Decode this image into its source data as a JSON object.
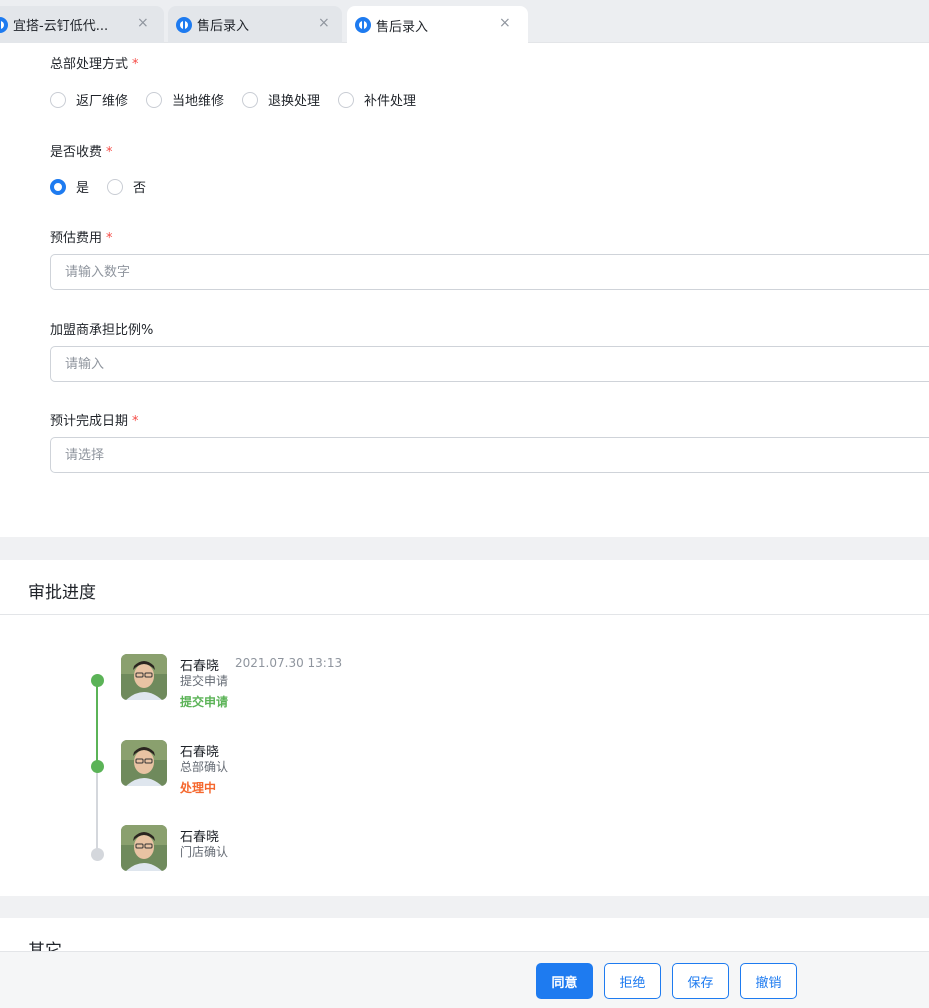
{
  "tabs": [
    {
      "title": "宜搭-云钉低代...",
      "close": "×"
    },
    {
      "title": "售后录入",
      "close": "×"
    },
    {
      "title": "售后录入",
      "close": "×"
    }
  ],
  "form": {
    "hq_method": {
      "label": "总部处理方式",
      "required_mark": "*",
      "options": [
        "返厂维修",
        "当地维修",
        "退换处理",
        "补件处理"
      ],
      "selected": null
    },
    "charge": {
      "label": "是否收费",
      "required_mark": "*",
      "options": [
        "是",
        "否"
      ],
      "selected": "是"
    },
    "estimated_fee": {
      "label": "预估费用",
      "required_mark": "*",
      "placeholder": "请输入数字",
      "value": ""
    },
    "franchisee_ratio": {
      "label": "加盟商承担比例%",
      "placeholder": "请输入",
      "value": ""
    },
    "expected_date": {
      "label": "预计完成日期",
      "required_mark": "*",
      "placeholder": "请选择",
      "value": ""
    }
  },
  "approval": {
    "title": "审批进度",
    "steps": [
      {
        "name": "石春晓",
        "time": "2021.07.30 13:13",
        "step": "提交申请",
        "status": "提交申请",
        "status_color": "#5bb357",
        "dot_color": "#5bb357"
      },
      {
        "name": "石春晓",
        "time": "",
        "step": "总部确认",
        "status": "处理中",
        "status_color": "#f5672d",
        "dot_color": "#5bb357"
      },
      {
        "name": "石春晓",
        "time": "",
        "step": "门店确认",
        "status": "",
        "status_color": "",
        "dot_color": "#d4d7dc"
      }
    ]
  },
  "other": {
    "title": "其它"
  },
  "actions": {
    "agree": "同意",
    "reject": "拒绝",
    "save": "保存",
    "revoke": "撤销"
  },
  "colors": {
    "accent": "#1e7bf0",
    "required": "#f54a45",
    "success": "#5bb357",
    "processing": "#f5672d"
  }
}
